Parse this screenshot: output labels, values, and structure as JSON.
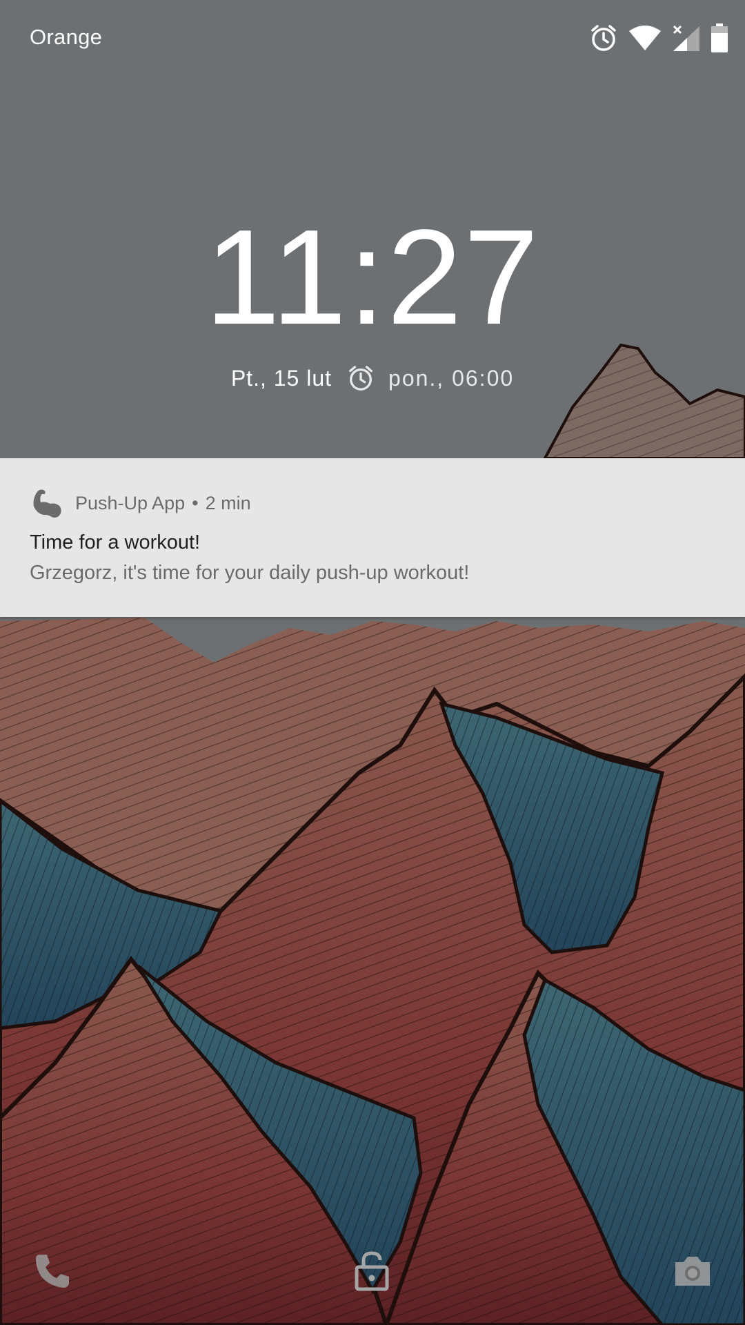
{
  "status_bar": {
    "carrier": "Orange",
    "icons": [
      "alarm-icon",
      "wifi-icon",
      "signal-no-sim-icon",
      "battery-icon"
    ]
  },
  "lockscreen": {
    "time": "11:27",
    "date": "Pt., 15 lut",
    "next_alarm": "pon., 06:00"
  },
  "notification": {
    "app_name": "Push-Up App",
    "separator": "•",
    "age": "2 min",
    "title": "Time for a workout!",
    "body": "Grzegorz, it's time for your daily push-up workout!",
    "icon": "flexed-arm-icon"
  },
  "bottom": {
    "left": "phone-icon",
    "center": "unlock-icon",
    "right": "camera-icon"
  },
  "colors": {
    "sky": "#6d7072",
    "notification_bg": "#e6e6e6",
    "mountain_red": "#7a3a36",
    "mountain_blue": "#2f5566"
  }
}
